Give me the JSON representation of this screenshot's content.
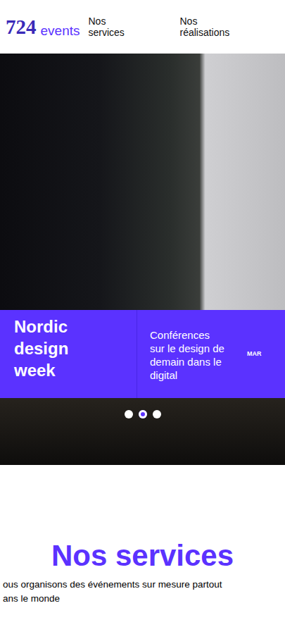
{
  "header": {
    "logo": {
      "number": "724",
      "word": "events"
    },
    "nav": [
      {
        "label": "Nos services"
      },
      {
        "label": "Nos réalisations"
      }
    ]
  },
  "slider": {
    "slide": {
      "title": [
        "Nordic",
        "design",
        "week"
      ],
      "description": [
        "Conférences",
        "sur le design de",
        "demain dans le",
        "digital"
      ],
      "date": "MAR"
    },
    "dots": [
      {
        "selected": false
      },
      {
        "selected": true
      },
      {
        "selected": false
      }
    ]
  },
  "services": {
    "title": "Nos services",
    "lines": [
      "ous organisons des événements sur mesure partout",
      "ans le monde"
    ]
  }
}
